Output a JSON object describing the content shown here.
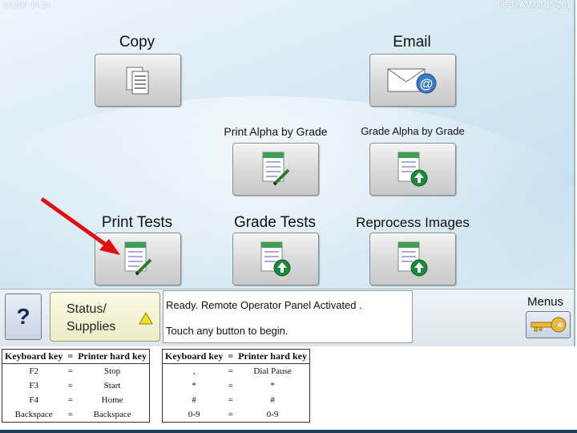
{
  "status_bar": {
    "left": "10:200 14:24",
    "right": "08:32 AM 08-15-201"
  },
  "tiles": [
    {
      "label": "Copy",
      "icon": "copy-icon"
    },
    {
      "label": "Email",
      "icon": "email-icon"
    },
    {
      "label": "Print Alpha by Grade",
      "icon": "print-document-icon"
    },
    {
      "label": "Grade Alpha by Grade",
      "icon": "grade-document-icon"
    },
    {
      "label": "Print Tests",
      "icon": "print-document-icon"
    },
    {
      "label": "Grade Tests",
      "icon": "grade-document-icon"
    },
    {
      "label": "Reprocess Images",
      "icon": "grade-document-icon"
    }
  ],
  "bottom_panel": {
    "help_label": "?",
    "status_line1": "Status/",
    "status_line2": "Supplies",
    "message_line1": "Ready. Remote Operator Panel Activated .",
    "message_line2": "Touch any button to begin.",
    "menus_label": "Menus"
  },
  "key_tables": [
    {
      "headers": [
        "Keyboard key",
        "=",
        "Printer hard key"
      ],
      "rows": [
        [
          "F2",
          "=",
          "Stop"
        ],
        [
          "F3",
          "=",
          "Start"
        ],
        [
          "F4",
          "=",
          "Home"
        ],
        [
          "Backspace",
          "=",
          "Backspace"
        ]
      ]
    },
    {
      "headers": [
        "Keyboard key",
        "=",
        "Printer hard key"
      ],
      "rows": [
        [
          ",",
          "=",
          "Dial Pause"
        ],
        [
          "*",
          "=",
          "*"
        ],
        [
          "#",
          "=",
          "#"
        ],
        [
          "0-9",
          "=",
          "0-9"
        ]
      ]
    }
  ],
  "colors": {
    "arrow": "#e01010",
    "warning": "#f2e21a",
    "key_gold": "#e8b93a",
    "upload_green": "#1a8a3a"
  }
}
